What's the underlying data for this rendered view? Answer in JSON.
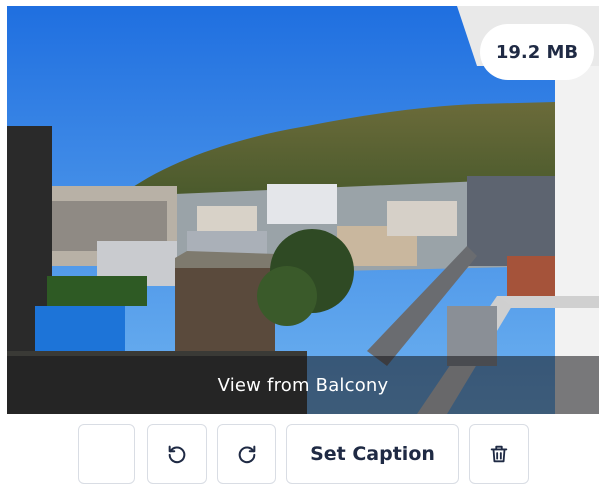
{
  "photo": {
    "file_size": "19.2 MB",
    "caption": "View from Balcony"
  },
  "toolbar": {
    "set_caption_label": "Set Caption",
    "icons": [
      "blank",
      "rotate-left-icon",
      "rotate-right-icon",
      "trash-icon"
    ]
  },
  "colors": {
    "text_dark": "#1f2a44",
    "border": "#d9dde4",
    "sky": "#3f8de0"
  }
}
